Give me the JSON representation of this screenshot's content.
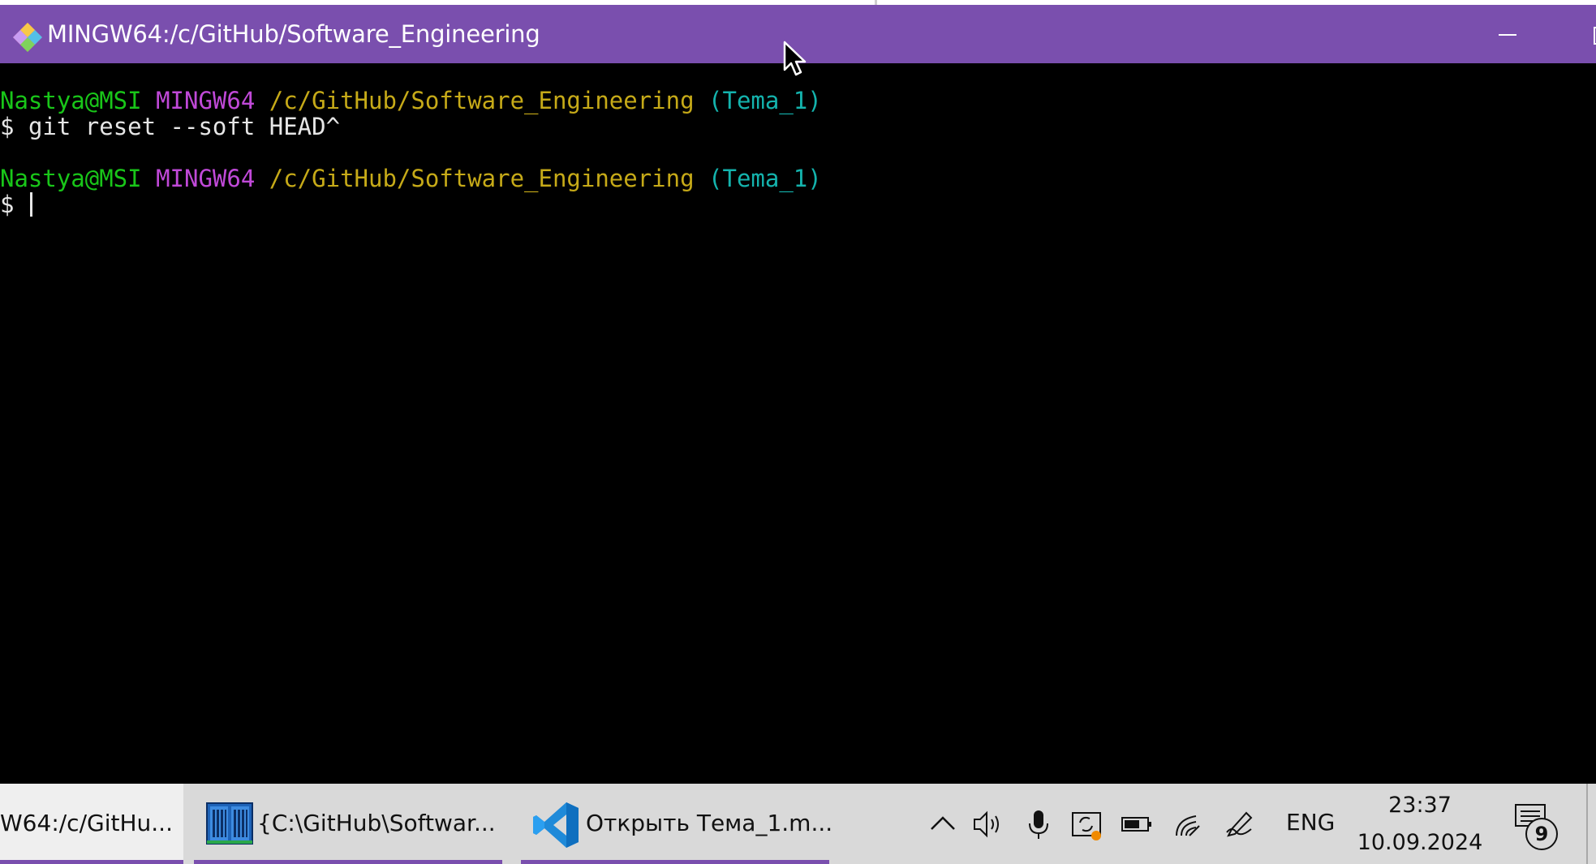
{
  "window": {
    "title": "MINGW64:/c/GitHub/Software_Engineering",
    "titlebar_color": "#7a4fae"
  },
  "terminal": {
    "lines": [
      {
        "user_host": "Nastya@MSI",
        "shell": "MINGW64",
        "path": "/c/GitHub/Software_Engineering",
        "branch": "(Tema_1)"
      },
      {
        "prompt": "$",
        "command": "git reset --soft HEAD^"
      },
      {
        "user_host": "Nastya@MSI",
        "shell": "MINGW64",
        "path": "/c/GitHub/Software_Engineering",
        "branch": "(Tema_1)"
      },
      {
        "prompt": "$",
        "command": ""
      }
    ],
    "colors": {
      "user_host": "#19c619",
      "shell": "#c049d8",
      "path": "#c6aa18",
      "branch": "#14b3ad",
      "text": "#e6e6e6",
      "background": "#000000"
    }
  },
  "taskbar": {
    "items": [
      {
        "label": "W64:/c/GitHu...",
        "icon": "git-bash-icon",
        "active": true
      },
      {
        "label": "{C:\\GitHub\\Softwar...",
        "icon": "file-manager-icon",
        "active": false
      },
      {
        "label": "Открыть Тема_1.m...",
        "icon": "vscode-icon",
        "active": false
      }
    ],
    "tray": {
      "icons": [
        "chevron-up-icon",
        "speaker-icon",
        "microphone-icon",
        "sync-icon",
        "battery-icon",
        "wifi-icon",
        "pen-icon"
      ],
      "language": "ENG",
      "time": "23:37",
      "date": "10.09.2024",
      "notification_count": "9"
    }
  }
}
